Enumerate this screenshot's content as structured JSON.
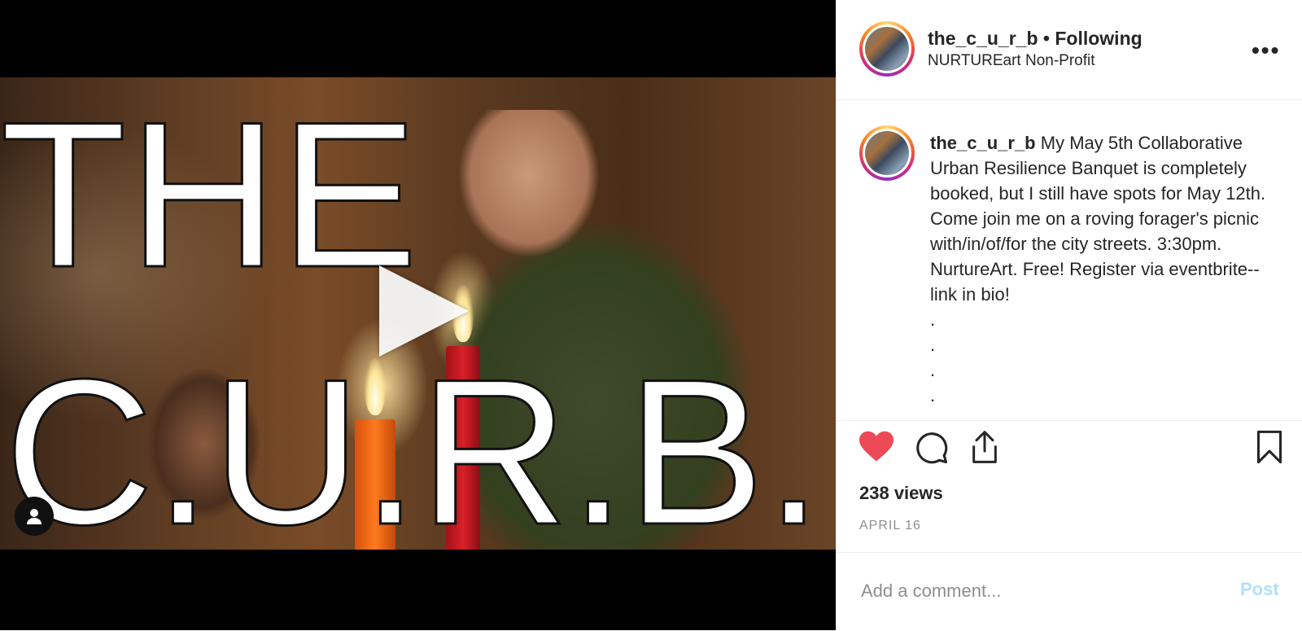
{
  "video": {
    "overlay_line1": "THE",
    "overlay_line2": "C.U.R.B."
  },
  "header": {
    "username": "the_c_u_r_b",
    "separator": "•",
    "follow_status": "Following",
    "location": "NURTUREart Non-Profit",
    "more_icon": "more-horizontal-icon"
  },
  "caption": {
    "username": "the_c_u_r_b",
    "text": "My May 5th Collaborative Urban Resilience Banquet is completely booked, but I still have spots for May 12th. Come join me on a roving forager's picnic with/in/of/for the city streets. 3:30pm. NurtureArt. Free! Register via eventbrite-- link in bio!",
    "dots": [
      ".",
      ".",
      ".",
      "."
    ]
  },
  "actions": {
    "like_icon": "heart-filled-icon",
    "comment_icon": "comment-icon",
    "share_icon": "share-icon",
    "save_icon": "bookmark-icon",
    "views": "238 views",
    "date": "APRIL 16",
    "like_color": "#ed4956"
  },
  "comment_box": {
    "placeholder": "Add a comment...",
    "post_label": "Post"
  }
}
